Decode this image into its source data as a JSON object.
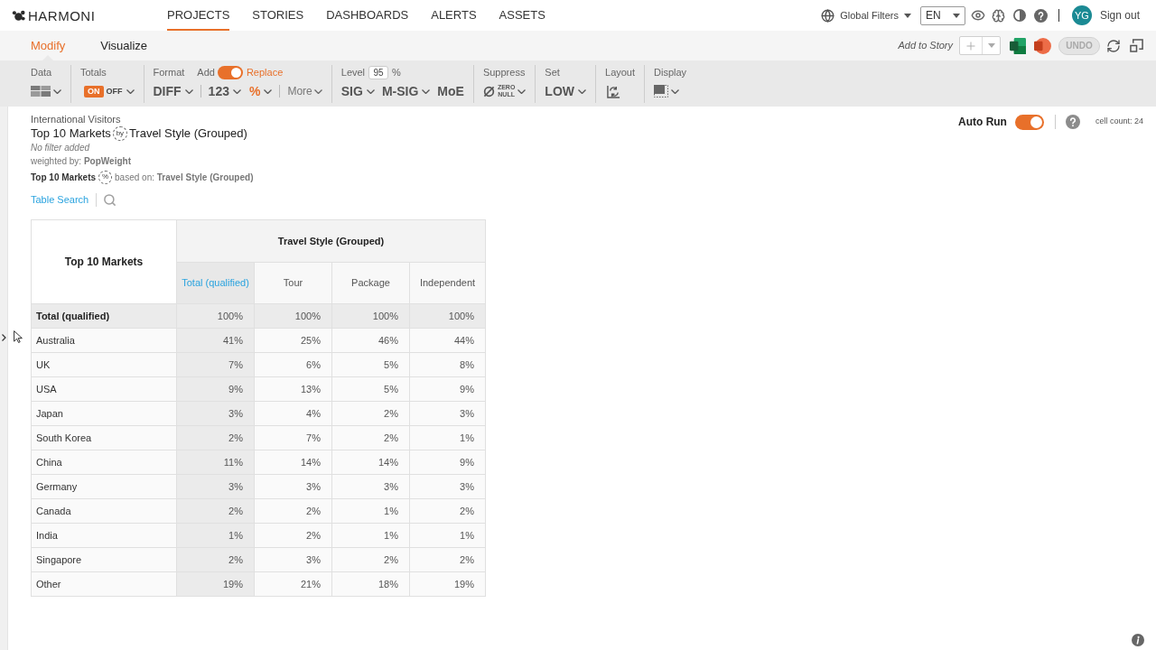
{
  "header": {
    "logo": "HARMONI",
    "nav": [
      {
        "label": "PROJECTS",
        "selected": true
      },
      {
        "label": "STORIES",
        "selected": false
      },
      {
        "label": "DASHBOARDS",
        "selected": false
      },
      {
        "label": "ALERTS",
        "selected": false
      },
      {
        "label": "ASSETS",
        "selected": false
      }
    ],
    "global_filters": "Global Filters",
    "language": "EN",
    "user_initials": "YG",
    "sign_out": "Sign out"
  },
  "mode_tabs": [
    {
      "label": "Modify",
      "selected": true
    },
    {
      "label": "Visualize",
      "selected": false
    }
  ],
  "story_actions": {
    "add_to_story": "Add to Story",
    "undo": {
      "label": "UNDO",
      "disabled": true
    }
  },
  "toolbar": [
    {
      "kind": "data",
      "label": "Data"
    },
    {
      "kind": "totals",
      "label": "Totals",
      "on_label": "ON",
      "off_label": "OFF",
      "on": true
    },
    {
      "kind": "format",
      "label": "Format",
      "left_option": "Add",
      "right_option": "Replace",
      "replace": true,
      "item_groups": [
        [
          {
            "kind": "dropdown",
            "label": "DIFF",
            "active": false
          }
        ],
        [
          {
            "kind": "dropdown",
            "label": "123",
            "active": false
          },
          {
            "kind": "dropdown",
            "label": "%",
            "active": true
          }
        ],
        [
          {
            "kind": "more",
            "label": "More",
            "active": false
          }
        ]
      ]
    },
    {
      "kind": "level",
      "label": "Level",
      "value": "95",
      "unit": "%",
      "items": [
        {
          "kind": "dropdown",
          "label": "SIG",
          "active": false
        },
        {
          "kind": "dropdown",
          "label": "M-SIG",
          "active": false
        },
        {
          "kind": "plain",
          "label": "MoE",
          "active": false
        }
      ]
    },
    {
      "kind": "suppress",
      "label": "Suppress",
      "options": [
        "ZERO",
        "NULL"
      ]
    },
    {
      "kind": "set",
      "label": "Set",
      "value": "LOW"
    },
    {
      "kind": "layout",
      "label": "Layout"
    },
    {
      "kind": "display",
      "label": "Display"
    }
  ],
  "report": {
    "dataset": "International Visitors",
    "title": {
      "rows": "Top 10 Markets",
      "relation": "by",
      "columns": "Travel Style (Grouped)"
    },
    "filter_note": "No filter added",
    "weighting": "weighted by: **PopWeight**",
    "percentage": {
      "rows": "Top 10 Markets",
      "symbol": "%",
      "basis": "based on: **Travel Style (Grouped)**"
    },
    "table_search": "Table Search"
  },
  "run_controls": {
    "auto_run": {
      "label": "Auto Run",
      "on": true
    },
    "cell_count": "cell count: 24"
  },
  "table": {
    "row_header": "Top 10 Markets",
    "column_group": "Travel Style (Grouped)",
    "columns": [
      {
        "label": "Total (qualified)",
        "kind": "total"
      },
      {
        "label": "Tour",
        "kind": "category"
      },
      {
        "label": "Package",
        "kind": "category"
      },
      {
        "label": "Independent",
        "kind": "category"
      }
    ],
    "rows": [
      {
        "label": "Total (qualified)",
        "kind": "total",
        "values": [
          "100%",
          "100%",
          "100%",
          "100%"
        ]
      },
      {
        "label": "Australia",
        "kind": "market",
        "values": [
          "41%",
          "25%",
          "46%",
          "44%"
        ]
      },
      {
        "label": "UK",
        "kind": "market",
        "values": [
          "7%",
          "6%",
          "5%",
          "8%"
        ]
      },
      {
        "label": "USA",
        "kind": "market",
        "values": [
          "9%",
          "13%",
          "5%",
          "9%"
        ]
      },
      {
        "label": "Japan",
        "kind": "market",
        "values": [
          "3%",
          "4%",
          "2%",
          "3%"
        ]
      },
      {
        "label": "South Korea",
        "kind": "market",
        "values": [
          "2%",
          "7%",
          "2%",
          "1%"
        ]
      },
      {
        "label": "China",
        "kind": "market",
        "values": [
          "11%",
          "14%",
          "14%",
          "9%"
        ]
      },
      {
        "label": "Germany",
        "kind": "market",
        "values": [
          "3%",
          "3%",
          "3%",
          "3%"
        ]
      },
      {
        "label": "Canada",
        "kind": "market",
        "values": [
          "2%",
          "2%",
          "1%",
          "2%"
        ]
      },
      {
        "label": "India",
        "kind": "market",
        "values": [
          "1%",
          "2%",
          "1%",
          "1%"
        ]
      },
      {
        "label": "Singapore",
        "kind": "market",
        "values": [
          "2%",
          "3%",
          "2%",
          "2%"
        ]
      },
      {
        "label": "Other",
        "kind": "market",
        "values": [
          "19%",
          "21%",
          "18%",
          "19%"
        ]
      }
    ]
  }
}
